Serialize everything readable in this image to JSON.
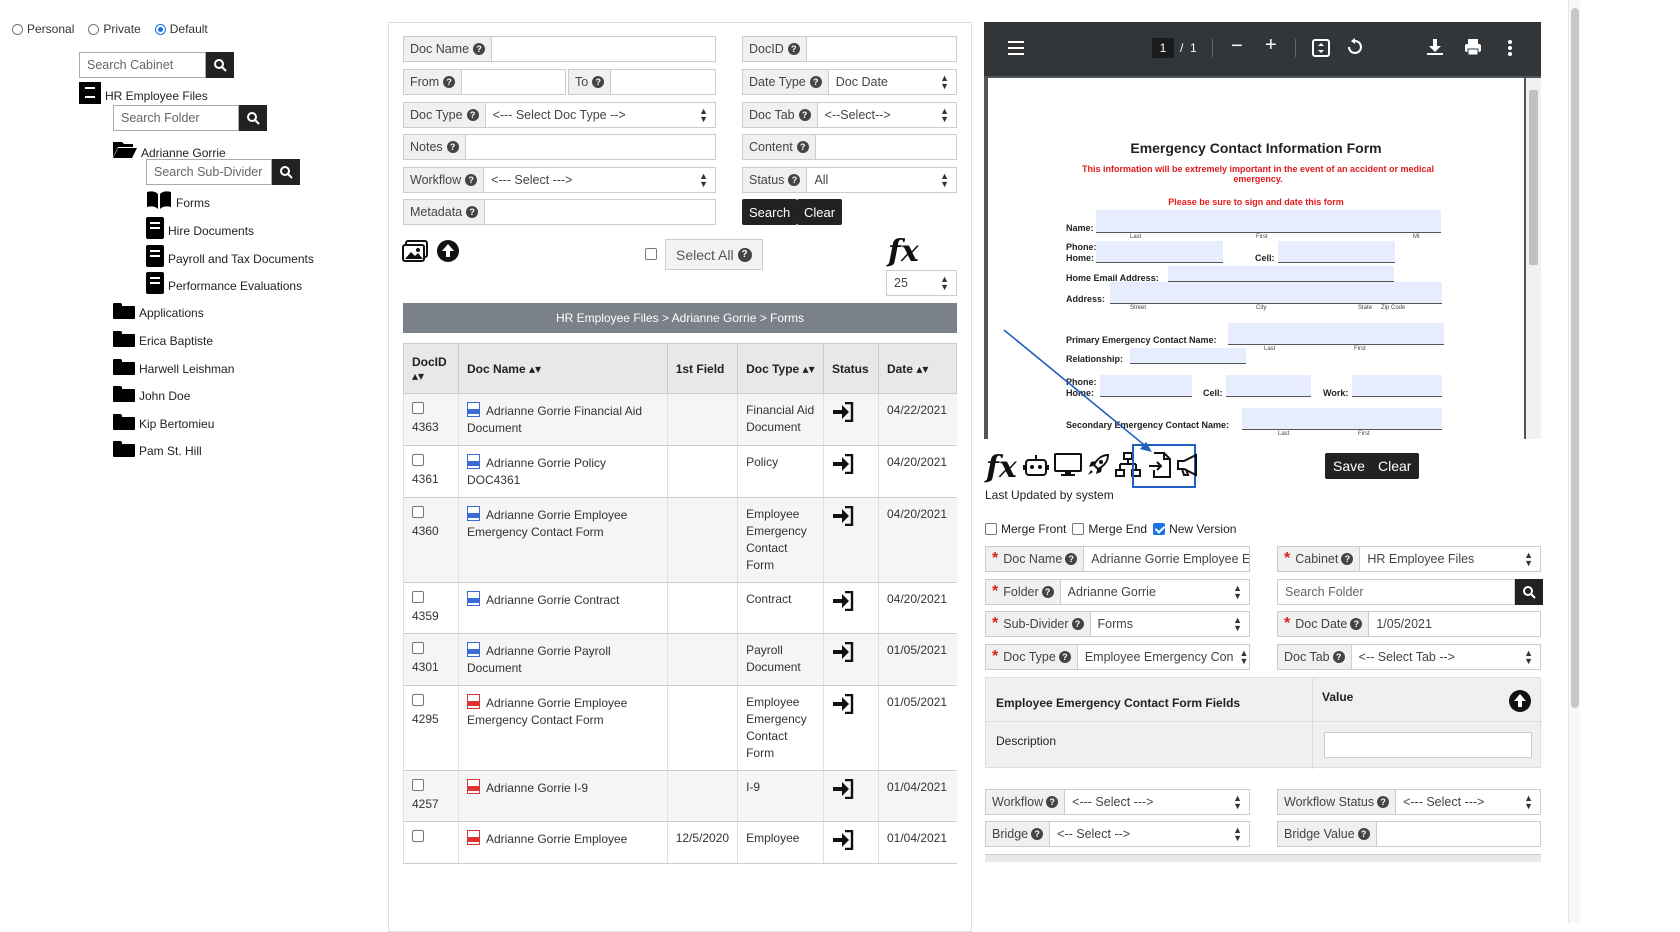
{
  "scope": {
    "options": [
      "Personal",
      "Private",
      "Default"
    ],
    "selected": "Default"
  },
  "tree": {
    "search_cabinet_placeholder": "Search Cabinet",
    "cabinet": "HR Employee Files",
    "search_folder_placeholder": "Search Folder",
    "open_folder": "Adrianne Gorrie",
    "search_subdivider_placeholder": "Search Sub-Divider",
    "subdividers": [
      "Forms",
      "Hire Documents",
      "Payroll and Tax Documents",
      "Performance Evaluations"
    ],
    "folders": [
      "Applications",
      "Erica Baptiste",
      "Harwell Leishman",
      "John Doe",
      "Kip Bertomieu",
      "Pam St. Hill"
    ]
  },
  "search": {
    "doc_name": "Doc Name",
    "docid": "DocID",
    "from": "From",
    "to": "To",
    "date_type": "Date Type",
    "date_type_value": "Doc Date",
    "doc_type": "Doc Type",
    "doc_type_value": "<--- Select Doc Type -->",
    "doc_tab": "Doc Tab",
    "doc_tab_value": "<--Select-->",
    "notes": "Notes",
    "content": "Content",
    "workflow": "Workflow",
    "workflow_value": "<--- Select --->",
    "status": "Status",
    "status_value": "All",
    "metadata": "Metadata",
    "search_btn": "Search",
    "clear_btn": "Clear",
    "select_all": "Select All",
    "fx": "fx",
    "page_size": "25"
  },
  "breadcrumb": "HR Employee Files > Adrianne Gorrie > Forms",
  "table": {
    "headers": {
      "docid": "DocID",
      "docname": "Doc Name",
      "first": "1st Field",
      "doctype": "Doc Type",
      "status": "Status",
      "date": "Date"
    },
    "rows": [
      {
        "id": "4363",
        "name": "Adrianne Gorrie Financial Aid Document",
        "first": "",
        "type": "Financial Aid Document",
        "date": "04/22/2021"
      },
      {
        "id": "4361",
        "name": "Adrianne Gorrie Policy DOC4361",
        "first": "",
        "type": "Policy",
        "date": "04/20/2021"
      },
      {
        "id": "4360",
        "name": "Adrianne Gorrie Employee Emergency Contact Form",
        "first": "",
        "type": "Employee Emergency Contact Form",
        "date": "04/20/2021"
      },
      {
        "id": "4359",
        "name": "Adrianne Gorrie Contract",
        "first": "",
        "type": "Contract",
        "date": "04/20/2021"
      },
      {
        "id": "4301",
        "name": "Adrianne Gorrie Payroll Document",
        "first": "",
        "type": "Payroll Document",
        "date": "01/05/2021"
      },
      {
        "id": "4295",
        "name": "Adrianne Gorrie Employee Emergency Contact Form",
        "first": "",
        "type": "Employee Emergency Contact Form",
        "date": "01/05/2021"
      },
      {
        "id": "4257",
        "name": "Adrianne Gorrie I-9",
        "first": "",
        "type": "I-9",
        "date": "01/04/2021"
      },
      {
        "id": "",
        "name": "Adrianne Gorrie Employee",
        "first": "12/5/2020",
        "type": "Employee",
        "date": "01/04/2021"
      }
    ]
  },
  "viewer": {
    "page_current": "1",
    "page_sep": "/",
    "page_total": "1",
    "form_title": "Emergency Contact Information Form",
    "form_warning": "This information will be extremely important in the event of an accident or medical emergency.",
    "form_sign": "Please be sure to sign and date this form",
    "labels": {
      "name": "Name:",
      "last": "Last",
      "first": "First",
      "mi": "MI",
      "phone": "Phone:",
      "home": "Home:",
      "cell": "Cell:",
      "home_email": "Home Email Address:",
      "address": "Address:",
      "street": "Street",
      "city": "City",
      "state": "State",
      "zip": "Zip Code",
      "primary": "Primary Emergency Contact Name:",
      "relationship": "Relationship:",
      "work": "Work:",
      "secondary": "Secondary Emergency Contact Name:"
    }
  },
  "toolbar": {
    "save": "Save",
    "clear": "Clear",
    "last_updated": "Last Updated by system"
  },
  "merge": {
    "front": "Merge Front",
    "end": "Merge End",
    "new_version": "New Version",
    "new_version_checked": true
  },
  "meta": {
    "doc_name": "Doc Name",
    "doc_name_value": "Adrianne Gorrie Employee E",
    "cabinet": "Cabinet",
    "cabinet_value": "HR Employee Files",
    "folder": "Folder",
    "folder_value": "Adrianne Gorrie",
    "search_folder_placeholder": "Search Folder",
    "subdivider": "Sub-Divider",
    "subdivider_value": "Forms",
    "doc_date": "Doc Date",
    "doc_date_value": "1/05/2021",
    "doc_type": "Doc Type",
    "doc_type_value": "Employee Emergency Con",
    "doc_tab": "Doc Tab",
    "doc_tab_value": "<-- Select Tab -->",
    "fields_title": "Employee Emergency Contact Form Fields",
    "value_col": "Value",
    "description": "Description",
    "workflow": "Workflow",
    "workflow_value": "<--- Select --->",
    "workflow_status": "Workflow Status",
    "workflow_status_value": "<--- Select --->",
    "bridge": "Bridge",
    "bridge_value": "<-- Select -->",
    "bridge_value_label": "Bridge Value"
  }
}
